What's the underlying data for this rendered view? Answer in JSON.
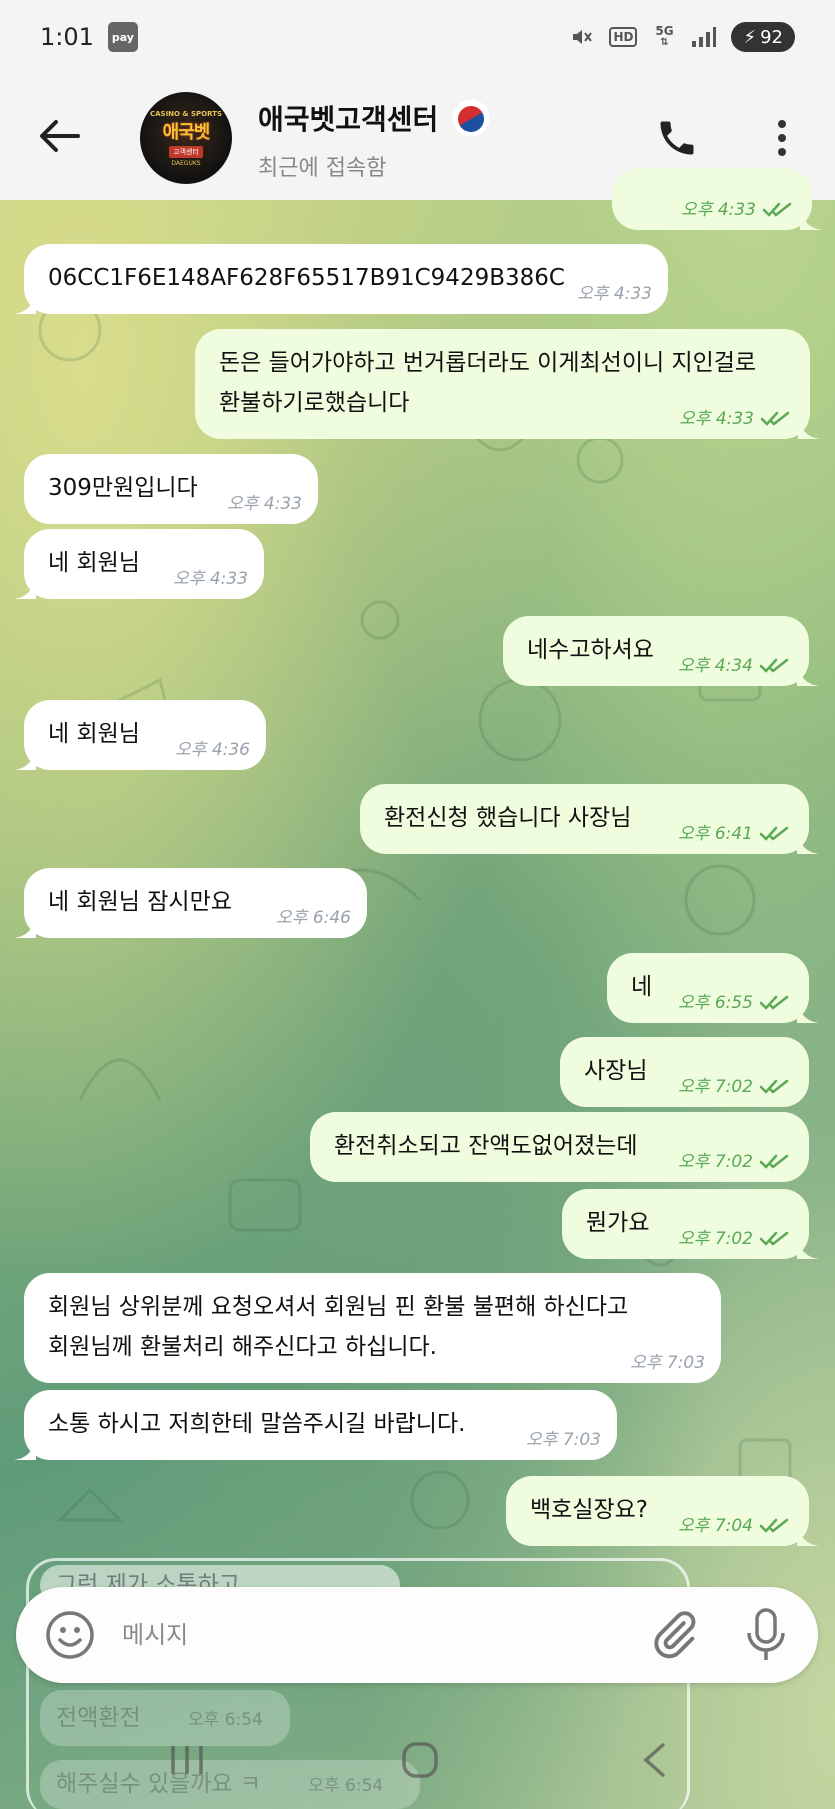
{
  "status_bar": {
    "time": "1:01",
    "pay_badge": "pay",
    "hd_label": "HD",
    "network_label": "5G",
    "battery_level": "92"
  },
  "header": {
    "title": "애국벳고객센터",
    "subtitle": "최근에 접속함",
    "avatar": {
      "top_text": "CASINO & SPORTS",
      "main_text": "애국벳",
      "sub_text": "고객센터",
      "domain_text": "DAEGUKS"
    }
  },
  "messages": [
    {
      "dir": "out",
      "text": "",
      "time": "오후 4:33",
      "read": true
    },
    {
      "dir": "in",
      "text": "06CC1F6E148AF628F65517B91C9429B386C",
      "time": "오후 4:33"
    },
    {
      "dir": "out",
      "lines": [
        "돈은 들어가야하고 번거롭더라도 이게최선이니 지인걸로",
        "환불하기로했습니다"
      ],
      "time": "오후 4:33",
      "read": true
    },
    {
      "dir": "in",
      "text": "309만원입니다",
      "time": "오후 4:33"
    },
    {
      "dir": "in",
      "text": "네 회원님",
      "time": "오후 4:33"
    },
    {
      "dir": "out",
      "text": "네수고하셔요",
      "time": "오후 4:34",
      "read": true
    },
    {
      "dir": "in",
      "text": "네 회원님",
      "time": "오후 4:36"
    },
    {
      "dir": "out",
      "text": "환전신청 했습니다 사장님",
      "time": "오후 6:41",
      "read": true
    },
    {
      "dir": "in",
      "text": "네 회원님 잠시만요",
      "time": "오후 6:46"
    },
    {
      "dir": "out",
      "text": "네",
      "time": "오후 6:55",
      "read": true
    },
    {
      "dir": "out",
      "text": "사장님",
      "time": "오후 7:02",
      "read": true
    },
    {
      "dir": "out",
      "text": "환전취소되고 잔액도없어졌는데",
      "time": "오후 7:02",
      "read": true
    },
    {
      "dir": "out",
      "text": "뭔가요",
      "time": "오후 7:02",
      "read": true
    },
    {
      "dir": "in",
      "lines": [
        "회원님 상위분께 요청오셔서 회원님 핀 환불 불편해 하신다고",
        "회원님께 환불처리 해주신다고 하십니다."
      ],
      "time": "오후 7:03"
    },
    {
      "dir": "in",
      "text": "소통 하시고 저희한테 말씀주시길 바랍니다.",
      "time": "오후 7:03"
    },
    {
      "dir": "out",
      "text": "백호실장요?",
      "time": "오후 7:04",
      "read": true
    }
  ],
  "underlay": {
    "line1": "그런 제가 소통하고",
    "line2": "전액환전",
    "line2_time": "오후 6:54",
    "line3": "해주실수 있을까요 ㅋ",
    "line3_time": "오후 6:54"
  },
  "composer": {
    "placeholder": "메시지"
  },
  "colors": {
    "incoming_bubble": "#ffffff",
    "outgoing_bubble": "#effdde",
    "outgoing_meta": "#5aa855",
    "incoming_meta": "#9aa3ad"
  }
}
